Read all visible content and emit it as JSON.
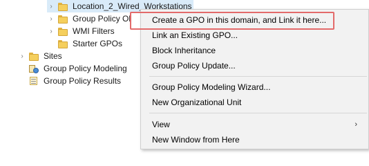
{
  "tree": {
    "items": [
      {
        "label": "Location_2_Wired_Workstations",
        "icon": "folder-icon",
        "expander": "chevron-right"
      },
      {
        "label": "Group Policy Ol",
        "icon": "gpo-folder-icon",
        "expander": "chevron-right"
      },
      {
        "label": "WMI Filters",
        "icon": "folder-icon",
        "expander": "chevron-right"
      },
      {
        "label": "Starter GPOs",
        "icon": "folder-icon",
        "expander": ""
      },
      {
        "label": "Sites",
        "icon": "folder-icon",
        "expander": "chevron-right"
      },
      {
        "label": "Group Policy Modeling",
        "icon": "gp-modeling-icon",
        "expander": ""
      },
      {
        "label": "Group Policy Results",
        "icon": "gp-results-icon",
        "expander": ""
      }
    ]
  },
  "context_menu": {
    "items": [
      {
        "label": "Create a GPO in this domain, and Link it here...",
        "highlighted": true
      },
      {
        "label": "Link an Existing GPO..."
      },
      {
        "label": "Block Inheritance"
      },
      {
        "label": "Group Policy Update..."
      },
      {
        "label": "Group Policy Modeling Wizard..."
      },
      {
        "label": "New Organizational Unit"
      },
      {
        "label": "View",
        "submenu": true
      },
      {
        "label": "New Window from Here"
      }
    ],
    "submenu_glyph": "›"
  },
  "colors": {
    "highlight_border": "#e36a6a",
    "menu_background": "#f2f2f2",
    "selection": "#d9ebf9"
  }
}
